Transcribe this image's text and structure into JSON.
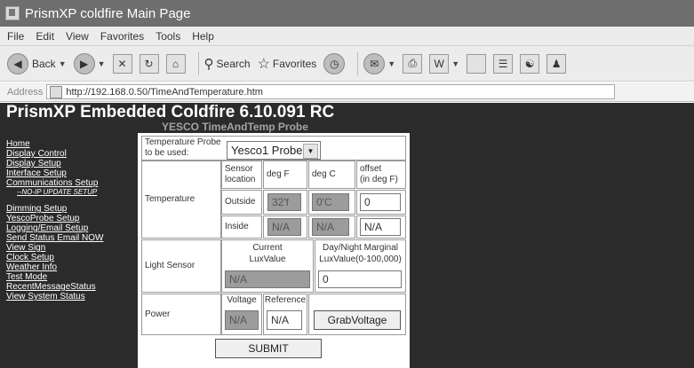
{
  "window": {
    "title": "PrismXP coldfire Main Page"
  },
  "menu": [
    "File",
    "Edit",
    "View",
    "Favorites",
    "Tools",
    "Help"
  ],
  "toolbar": {
    "back_label": "Back",
    "search_label": "Search",
    "favorites_label": "Favorites"
  },
  "address": {
    "label": "Address",
    "url": "http://192.168.0.50/TimeAndTemperature.htm"
  },
  "page": {
    "title": "PrismXP Embedded Coldfire 6.10.091 RC",
    "subtitle": "YESCO TimeAndTemp Probe"
  },
  "nav": {
    "home": "Home",
    "display_control": "Display Control",
    "display_setup": "Display Setup",
    "interface_setup": "Interface Setup",
    "communications_setup": "Communications Setup",
    "no_ip": "--NO-IP UPDATE SETUP",
    "dimming_setup": "Dimming Setup",
    "yescoprobe_setup": "YescoProbe Setup",
    "logging_email_setup": "Logging/Email Setup",
    "send_status_email": "Send Status Email NOW",
    "view_sign": "View Sign",
    "clock_setup": "Clock Setup",
    "weather_info": "Weather Info",
    "test_mode": "Test Mode",
    "recent_message_status": "RecentMessageStatus",
    "view_system_status": "View System Status"
  },
  "form": {
    "probe_label_1": "Temperature Probe",
    "probe_label_2": "to be used:",
    "probe_value": "Yesco1 Probe",
    "temperature_label": "Temperature",
    "sensor_location_1": "Sensor",
    "sensor_location_2": "location",
    "deg_f": "deg F",
    "deg_c": "deg C",
    "offset_1": "offset",
    "offset_2": "(in deg F)",
    "outside_label": "Outside",
    "outside_f": "32'f",
    "outside_c": "0'C",
    "outside_offset": "0",
    "inside_label": "Inside",
    "inside_f": "N/A",
    "inside_c": "N/A",
    "inside_offset": "N/A",
    "light_label": "Light Sensor",
    "current_1": "Current",
    "current_2": "LuxValue",
    "marginal_1": "Day/Night Marginal",
    "marginal_2": "LuxValue(0-100,000)",
    "lux_value": "N/A",
    "marginal_value": "0",
    "power_label": "Power",
    "voltage_label": "Voltage",
    "reference_label": "Reference",
    "voltage_value": "N/A",
    "reference_value": "N/A",
    "grab_voltage": "GrabVoltage",
    "submit": "SUBMIT"
  }
}
